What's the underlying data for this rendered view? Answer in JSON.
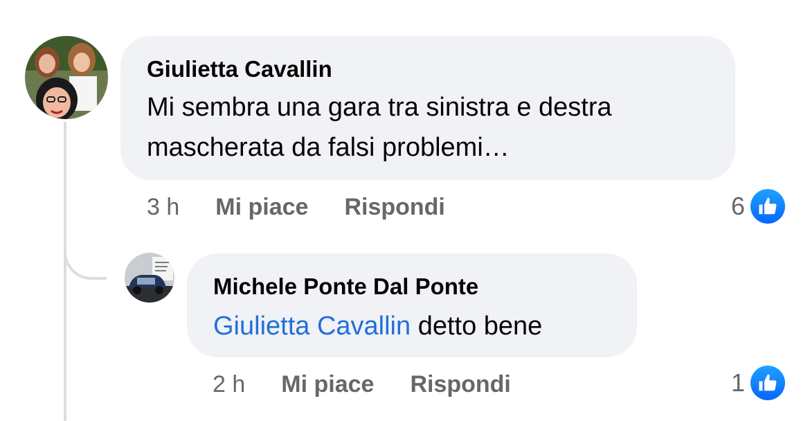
{
  "comments": [
    {
      "author": "Giulietta Cavallin",
      "text": "Mi sembra una gara tra sinistra e destra mascherata da falsi problemi…",
      "time": "3 h",
      "like_label": "Mi piace",
      "reply_label": "Rispondi",
      "reaction_count": "6",
      "reaction_icon": "thumbs-up-icon"
    },
    {
      "author": "Michele Ponte Dal Ponte",
      "mention": "Giulietta Cavallin",
      "text": " detto bene",
      "time": "2 h",
      "like_label": "Mi piace",
      "reply_label": "Rispondi",
      "reaction_count": "1",
      "reaction_icon": "thumbs-up-icon"
    }
  ],
  "colors": {
    "bubble": "#f0f2f5",
    "mention": "#216fdb",
    "meta_text": "#65676b",
    "like_blue": "#0866ff"
  }
}
